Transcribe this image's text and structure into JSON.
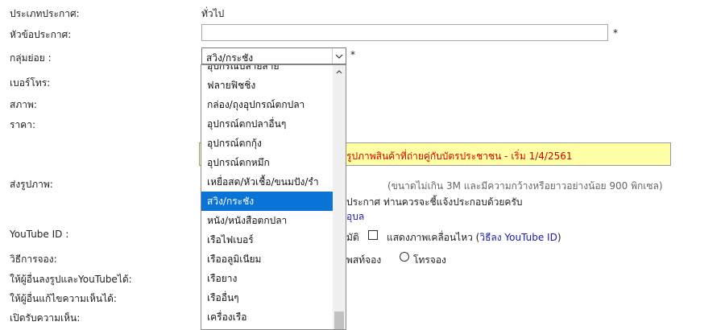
{
  "form": {
    "type_label": "ประเภทประกาศ:",
    "type_value": "ทั่วไป",
    "title_label": "หัวข้อประกาศ:",
    "title_value": "",
    "title_required": "*",
    "group_label": "กลุ่มย่อย :",
    "group_selected": "สวิง/กระชัง",
    "group_required": "*",
    "phone_label": "เบอร์โทร:",
    "condition_label": "สภาพ:",
    "price_label": "ราคา:",
    "notice_text": "รูปภาพสินค้าที่ถ่ายคู่กับบัตรประชาชน - เริ่ม 1/4/2561",
    "photos_label": "ส่งรูปภาพ:",
    "photos_hint": "(ขนาดไม่เกิน 3M และมีความกว้างหรือยาวอย่างน้อย 900 พิกเซล)",
    "photos_note": "ประกาศ ท่านควรจะชี้แจ้งประกอบด้วยครับ",
    "photos_link": "อุบล",
    "youtube_label": "YouTube ID :",
    "youtube_partial": "มัติ",
    "youtube_checkbox_label": "แสดงภาพเคลื่อนไหว (",
    "youtube_link": "วิธีลง YouTube ID",
    "youtube_close": ")",
    "booking_label": "วิธีการจอง:",
    "booking_partial": "พสท์จอง",
    "booking_radio_label": "โทรจอง",
    "allow_upload_label": "ให้ผู้อื่นลงรูปและYouTubeได้:",
    "allow_edit_label": "ให้ผู้อื่นแก้ไขความเห็นได้:",
    "open_comments_label": "เปิดรับความเห็น:"
  },
  "dropdown": {
    "items": [
      "อุปกรณ์ปลายสาย",
      "ฟลายฟิชชิ่ง",
      "กล่อง/ถุงอุปกรณ์ตกปลา",
      "อุปกรณ์ตกปลาอื่นๆ",
      "อุปกรณ์ตกกุ้ง",
      "อุปกรณ์ตกหมึก",
      "เหยื่อสด/หัวเชื้อ/ขนมปัง/รำ",
      "สวิง/กระชัง",
      "หนัง/หนังสือตกปลา",
      "เรือไฟเบอร์",
      "เรืออลูมิเนียม",
      "เรือยาง",
      "เรืออื่นๆ",
      "เครื่องเรือ"
    ],
    "selected_index": 7
  },
  "colors": {
    "selected_bg": "#0a73d6",
    "notice_bg": "#ffffa6",
    "notice_text": "#d40000",
    "link": "#1a1aa8"
  }
}
